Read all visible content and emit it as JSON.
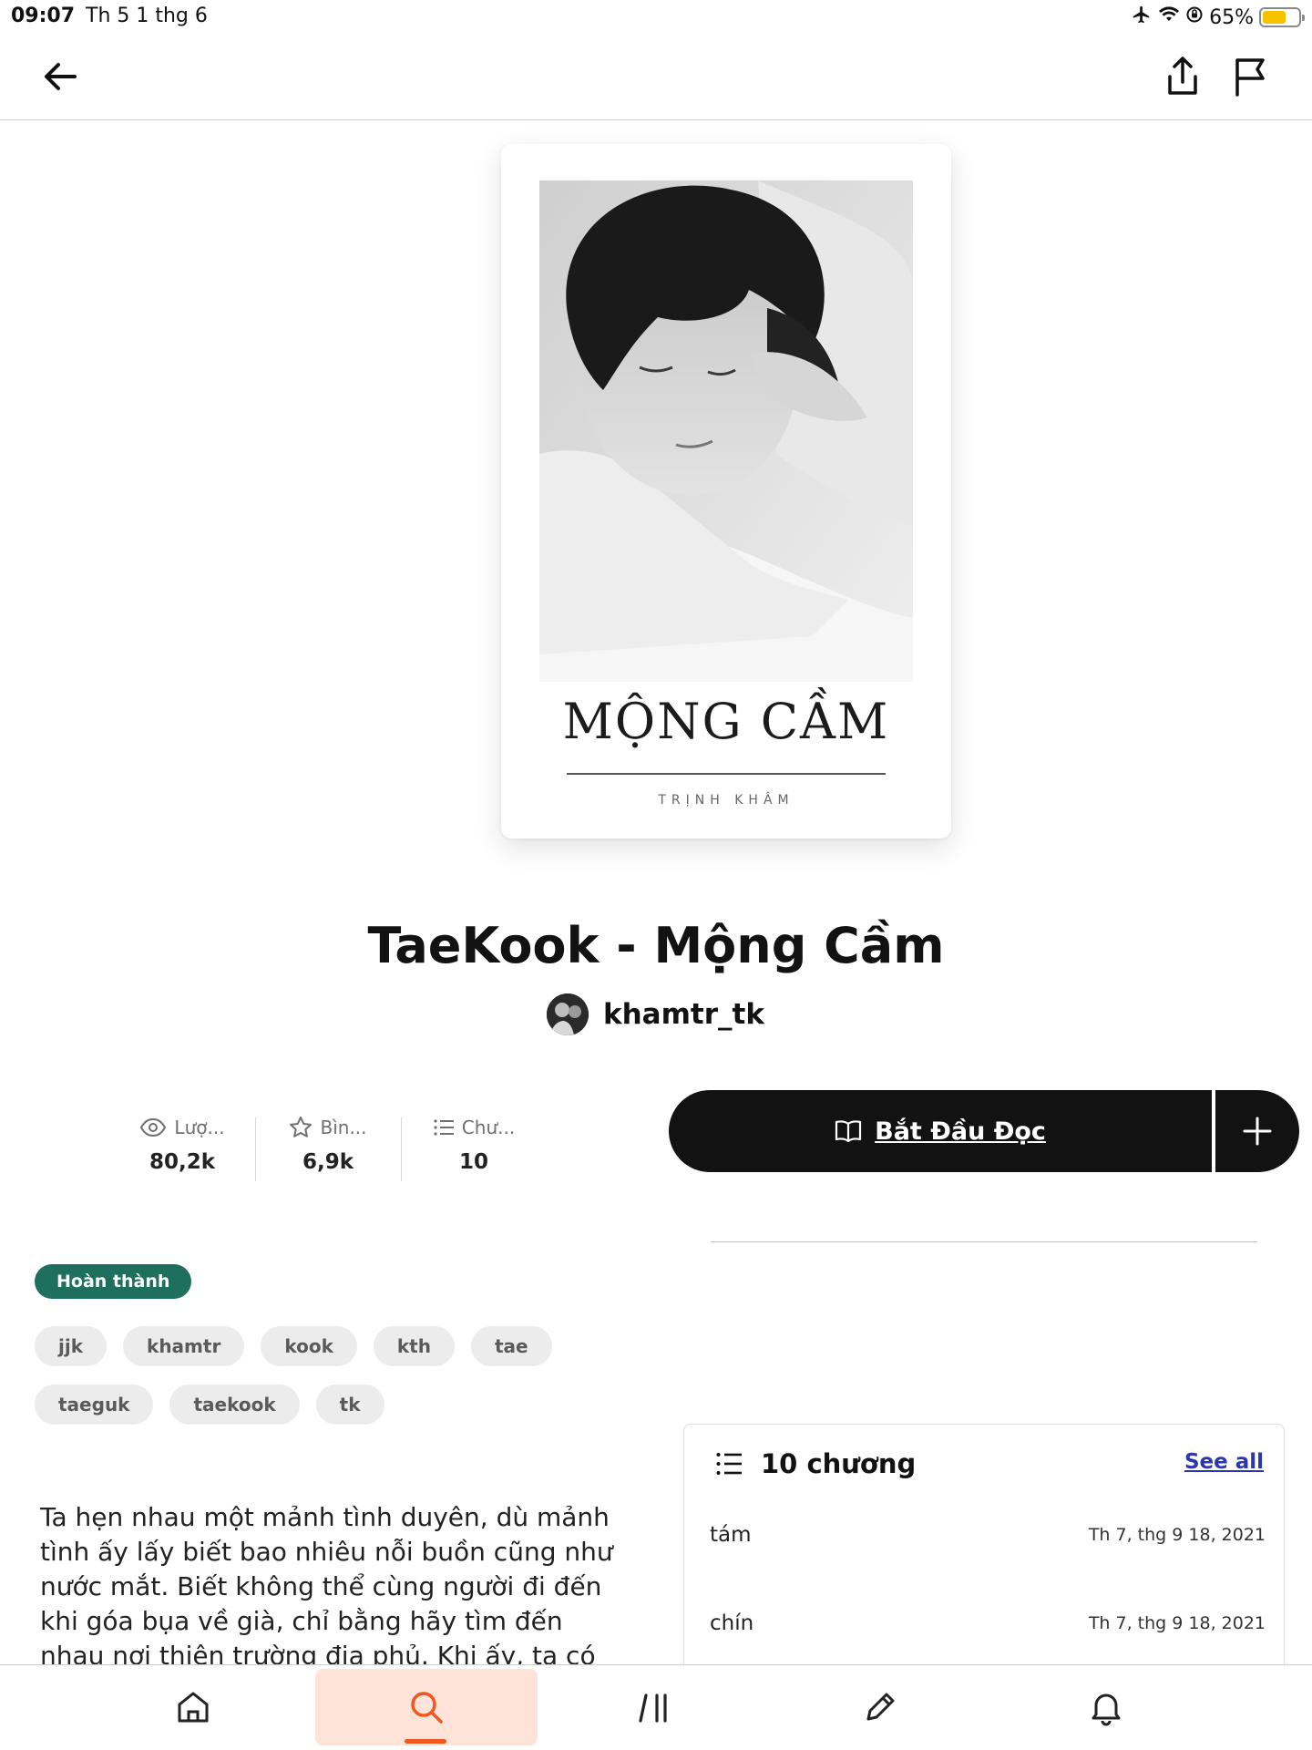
{
  "status_bar": {
    "time": "09:07",
    "date": "Th 5 1 thg 6",
    "battery_percent": "65%",
    "battery_level": 0.65,
    "battery_color": "#f7c200",
    "icons": [
      "airplane-icon",
      "wifi-icon",
      "rotation-lock-icon"
    ]
  },
  "top_nav": {
    "icons": [
      "back-arrow-icon",
      "share-icon",
      "flag-icon"
    ]
  },
  "cover": {
    "title": "MỘNG CẦM",
    "author": "TRỊNH KHÂM"
  },
  "story": {
    "title": "TaeKook - Mộng Cầm",
    "author": "khamtr_tk"
  },
  "stats": [
    {
      "icon": "eye-icon",
      "label": "Lượ...",
      "value": "80,2k"
    },
    {
      "icon": "star-icon",
      "label": "Bìn...",
      "value": "6,9k"
    },
    {
      "icon": "list-icon",
      "label": "Chư...",
      "value": "10"
    }
  ],
  "actions": {
    "read_label": "Bắt Đầu Đọc",
    "read_icon": "book-open-icon",
    "add_icon": "plus-icon"
  },
  "status_badge": "Hoàn thành",
  "tags": [
    "jjk",
    "khamtr",
    "kook",
    "kth",
    "tae",
    "taeguk",
    "taekook",
    "tk"
  ],
  "description": "Ta hẹn nhau một mảnh tình duyên, dù mảnh tình ấy lấy biết bao nhiêu nỗi buồn cũng như nước mắt. Biết không thể cùng người đi đến khi góa bụa về già, chỉ bằng hãy tìm đến nhau nơi thiên trường địa phủ. Khi ấy, ta có nhau...",
  "chapters": {
    "title": "10 chương",
    "see_all": "See all",
    "items": [
      {
        "name": "tám",
        "date": "Th 7, thg 9 18, 2021"
      },
      {
        "name": "chín",
        "date": "Th 7, thg 9 18, 2021"
      }
    ]
  },
  "tab_bar": {
    "tabs": [
      "home-icon",
      "search-icon",
      "library-icon",
      "write-icon",
      "bell-icon"
    ],
    "active_tab": "search-icon",
    "accent_color": "#f3561f"
  },
  "colors": {
    "badge": "#1f6f5f",
    "link": "#2b36b0",
    "primary_button": "#121212"
  }
}
